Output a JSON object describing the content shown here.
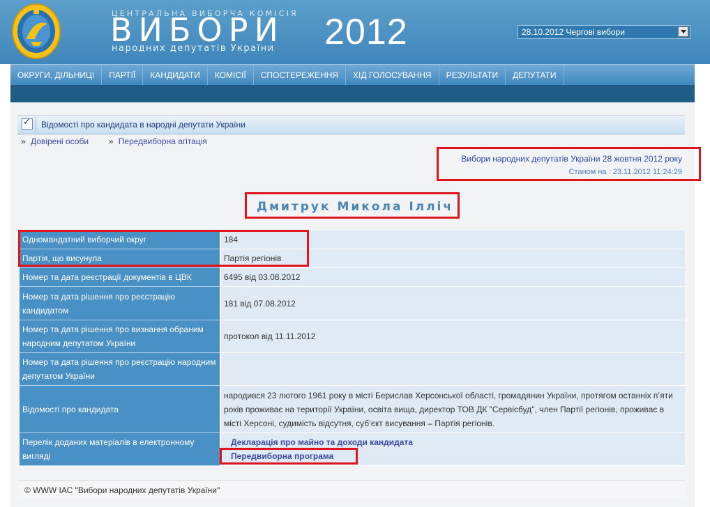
{
  "header": {
    "caption": "ЦЕНТРАЛЬНА ВИБОРЧА КОМІСІЯ",
    "title": "ВИБОРИ",
    "subtitle": "народних депутатів України",
    "year": "2012",
    "election_select": "28.10.2012 Чергові вибори"
  },
  "nav": [
    "ОКРУГИ, ДІЛЬНИЦІ",
    "ПАРТІЇ",
    "КАНДИДАТИ",
    "КОМІСІЇ",
    "СПОСТЕРЕЖЕННЯ",
    "ХІД ГОЛОСУВАННЯ",
    "РЕЗУЛЬТАТИ",
    "ДЕПУТАТИ"
  ],
  "section_title": "Відомості про кандидата в народні депутати України",
  "breadcrumbs": [
    {
      "sep": "»",
      "label": "Довірені особи"
    },
    {
      "sep": "»",
      "label": "Передвиборна агітація"
    }
  ],
  "election_title": "Вибори народних депутатів України 28 жовтня 2012 року",
  "status_stamp": "Станом на : 23.11.2012 11:24:29",
  "candidate_name": "Дмитрук Микола Ілліч",
  "rows": [
    {
      "key": "Одномандатний виборчий округ",
      "value": "184"
    },
    {
      "key": "Партія, що висунула",
      "value": "Партія регіонів"
    },
    {
      "key": "Номер та дата реєстрації документів в ЦВК",
      "value": "6495 від 03.08.2012"
    },
    {
      "key": "Номер та дата рішення про реєстрацію кандидатом",
      "value": "181 від 07.08.2012"
    },
    {
      "key": "Номер та дата рішення про визнання обраним народним депутатом України",
      "value": "протокол від 11.11.2012"
    },
    {
      "key": "Номер та дата рішення про реєстрацію народним депутатом України",
      "value": ""
    },
    {
      "key": "Відомості про кандидата",
      "value": "народився 23 лютого 1961 року в місті Берислав Херсонської області, громадянин України, протягом останніх п’яти років проживає на території України, освіта вища, директор ТОВ ДК \"Сервісбуд\", член Партії регіонів, проживає в місті Херсоні, судимість відсутня, суб’єкт висування – Партія регіонів."
    },
    {
      "key": "Перелік доданих матеріалів в електронному вигляді",
      "links": [
        "Декларація про майно та доходи кандидата",
        "Передвиборна програма"
      ]
    }
  ],
  "footer": "© WWW ІАС \"Вибори народних депутатів України\"",
  "colors": {
    "header": "#4a90c4",
    "key_cell": "#4990c5",
    "value_cell": "#dfeaf4",
    "highlight": "#e0141c",
    "link": "#3b4aa0"
  }
}
